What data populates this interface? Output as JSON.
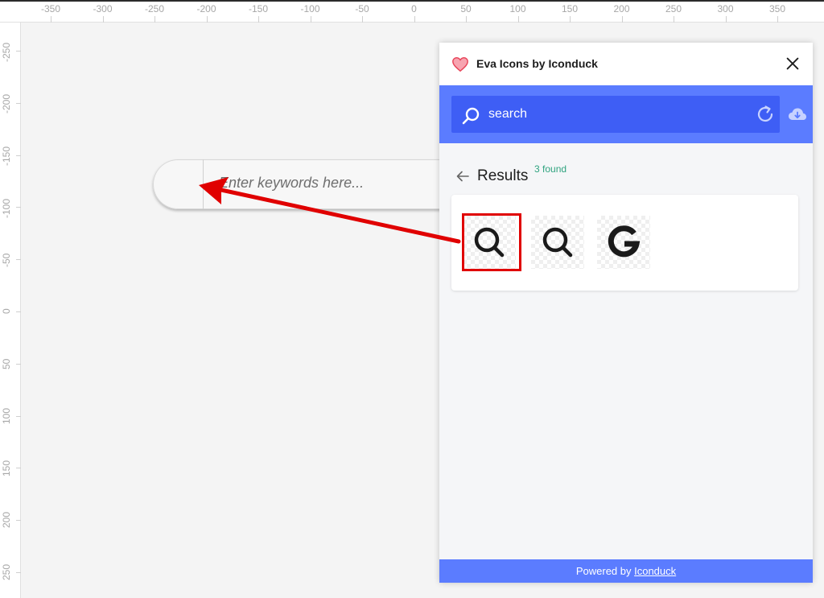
{
  "ruler": {
    "x_labels": [
      "-350",
      "-300",
      "-250",
      "-200",
      "-150",
      "-100",
      "-50",
      "0",
      "50",
      "100",
      "150",
      "200",
      "250",
      "300",
      "350"
    ],
    "y_labels": [
      "-250",
      "-200",
      "-150",
      "-100",
      "-50",
      "0",
      "50",
      "100",
      "150",
      "200",
      "250"
    ]
  },
  "canvas": {
    "search_placeholder": "Enter keywords here..."
  },
  "plugin": {
    "title": "Eva Icons by Iconduck",
    "search_value": "search",
    "results_label": "Results",
    "found_label": "3 found",
    "results": [
      {
        "icon": "search-icon",
        "selected": true
      },
      {
        "icon": "search-outline-icon",
        "selected": false
      },
      {
        "icon": "google-icon",
        "selected": false
      }
    ],
    "footer_prefix": "Powered by ",
    "footer_link": "Iconduck"
  },
  "colors": {
    "accent": "#5b7cff",
    "search_box": "#3e5ef5",
    "highlight": "#e00000",
    "found": "#2fa37f",
    "heart": "#f06a7a"
  }
}
